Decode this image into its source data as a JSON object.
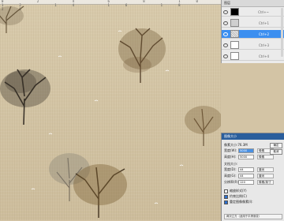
{
  "ruler": {
    "marks": "0 2 4 6 8 10 12 14 16 18 20"
  },
  "layers": {
    "header": "图层",
    "rows": [
      {
        "name": "",
        "ctrl": "Ctrl+~",
        "thumb": "black",
        "selected": false
      },
      {
        "name": "",
        "ctrl": "Ctrl+1",
        "thumb": "gray",
        "selected": false
      },
      {
        "name": "",
        "ctrl": "Ctrl+2",
        "thumb": "pattern",
        "selected": true
      },
      {
        "name": "",
        "ctrl": "Ctrl+3",
        "thumb": "white",
        "selected": false
      },
      {
        "name": "",
        "ctrl": "Ctrl+4",
        "thumb": "white",
        "selected": false
      }
    ]
  },
  "dialog": {
    "title": "图像大小",
    "pixel_size": "像素大小:76.3M",
    "width_label": "宽度(W):",
    "width_value": "5000",
    "width_unit": "像素",
    "height_label": "高度(H):",
    "height_value": "5000",
    "height_unit": "像素",
    "doc_size": "文档大小:",
    "doc_width_label": "宽度(D):",
    "doc_width_value": "44",
    "doc_width_unit": "厘米",
    "doc_height_label": "高度(G):",
    "doc_height_value": "44",
    "doc_height_unit": "厘米",
    "res_label": "分辨率(R):",
    "res_value": "120",
    "res_unit": "像素/英寸",
    "scale_styles": "缩放样式(Y)",
    "constrain": "约束比例(C)",
    "resample": "重定图像像素(I):",
    "resample_method": "两次立方（适用于平滑渐变）",
    "ok": "确定",
    "cancel": "取消"
  }
}
